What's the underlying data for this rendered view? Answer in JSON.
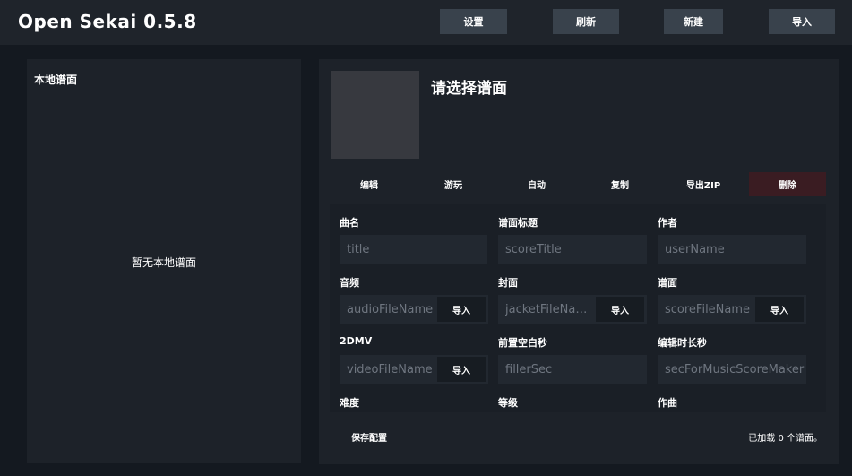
{
  "app": {
    "title": "Open Sekai 0.5.8"
  },
  "toolbar": {
    "settings_label": "设置",
    "refresh_label": "刷新",
    "new_label": "新建",
    "import_label": "导入"
  },
  "local_scores": {
    "title": "本地谱面",
    "empty_text": "暂无本地谱面"
  },
  "detail": {
    "title": "请选择谱面",
    "actions": {
      "edit": "编辑",
      "play": "游玩",
      "auto": "自动",
      "copy": "复制",
      "export_zip": "导出ZIP",
      "delete": "删除"
    }
  },
  "form": {
    "song_name": {
      "label": "曲名",
      "placeholder": "title",
      "value": ""
    },
    "score_title": {
      "label": "谱面标题",
      "placeholder": "scoreTitle",
      "value": ""
    },
    "author": {
      "label": "作者",
      "placeholder": "userName",
      "value": ""
    },
    "audio": {
      "label": "音频",
      "placeholder": "audioFileName",
      "value": "",
      "import_label": "导入"
    },
    "cover": {
      "label": "封面",
      "placeholder": "jacketFileNa…",
      "value": "",
      "import_label": "导入"
    },
    "score": {
      "label": "谱面",
      "placeholder": "scoreFileName",
      "value": "",
      "import_label": "导入"
    },
    "mv2d": {
      "label": "2DMV",
      "placeholder": "videoFileName",
      "value": "",
      "import_label": "导入"
    },
    "pre_blank": {
      "label": "前置空白秒",
      "placeholder": "fillerSec",
      "value": ""
    },
    "edit_duration": {
      "label": "编辑时长秒",
      "placeholder": "secForMusicScoreMaker",
      "value": ""
    },
    "difficulty": {
      "label": "难度"
    },
    "level": {
      "label": "等级"
    },
    "composer": {
      "label": "作曲"
    }
  },
  "footer": {
    "save_label": "保存配置",
    "status_text": "已加载 0 个谱面。"
  },
  "colors": {
    "background": "#141920",
    "panel": "#1d2229",
    "button": "#39424c",
    "danger": "#3a1c22"
  }
}
